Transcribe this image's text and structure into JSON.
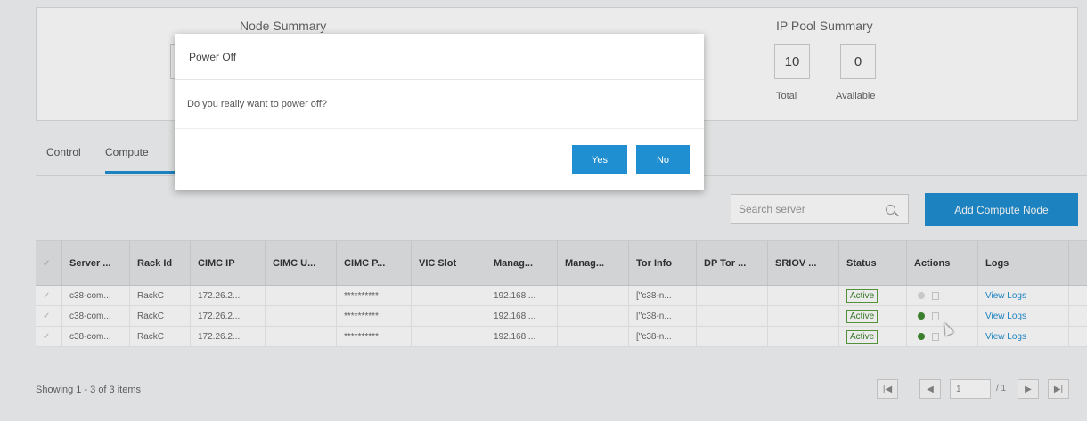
{
  "summary": {
    "node_title": "Node Summary",
    "ip_title": "IP Pool Summary",
    "ip_total_value": "10",
    "ip_available_value": "0",
    "ip_total_label": "Total",
    "ip_available_label": "Available"
  },
  "tabs": [
    {
      "label": "Control"
    },
    {
      "label": "Compute"
    }
  ],
  "toolbar": {
    "search_placeholder": "Search server",
    "add_label": "Add Compute Node"
  },
  "table": {
    "columns": [
      "Server ...",
      "Rack Id",
      "CIMC IP",
      "CIMC U...",
      "CIMC P...",
      "VIC Slot",
      "Manag...",
      "Manag...",
      "Tor Info",
      "DP Tor ...",
      "SRIOV ...",
      "Status",
      "Actions",
      "Logs"
    ],
    "rows": [
      {
        "server": "c38-com...",
        "rack": "RackC",
        "cimc_ip": "172.26.2...",
        "cimc_u": "",
        "cimc_p": "**********",
        "vic": "",
        "manag1": "192.168....",
        "manag2": "",
        "tor": "[\"c38-n...",
        "dp": "",
        "sriov": "",
        "status": "Active",
        "log": "View Logs"
      },
      {
        "server": "c38-com...",
        "rack": "RackC",
        "cimc_ip": "172.26.2...",
        "cimc_u": "",
        "cimc_p": "**********",
        "vic": "",
        "manag1": "192.168....",
        "manag2": "",
        "tor": "[\"c38-n...",
        "dp": "",
        "sriov": "",
        "status": "Active",
        "log": "View Logs"
      },
      {
        "server": "c38-com...",
        "rack": "RackC",
        "cimc_ip": "172.26.2...",
        "cimc_u": "",
        "cimc_p": "**********",
        "vic": "",
        "manag1": "192.168....",
        "manag2": "",
        "tor": "[\"c38-n...",
        "dp": "",
        "sriov": "",
        "status": "Active",
        "log": "View Logs"
      }
    ]
  },
  "footer": {
    "showing": "Showing 1 - 3 of 3 items",
    "page": "1",
    "of": "/ 1"
  },
  "modal": {
    "title": "Power Off",
    "message": "Do you really want to power off?",
    "yes_label": "Yes",
    "no_label": "No"
  },
  "colors": {
    "accent": "#1f8fd1",
    "active": "#3d7f2b"
  }
}
